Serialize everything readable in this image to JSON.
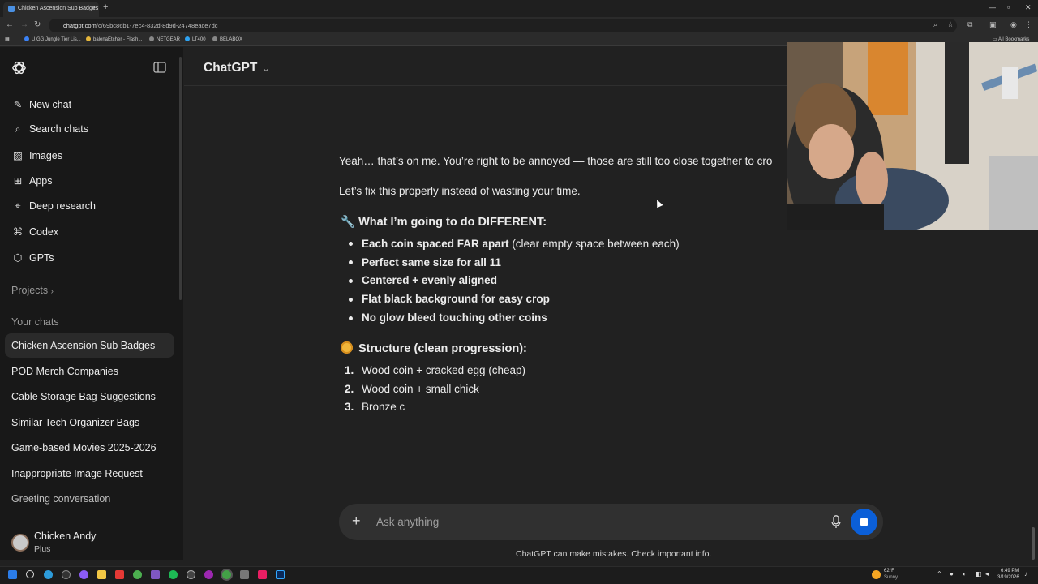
{
  "browser": {
    "tab_title": "Chicken Ascension Sub Badges",
    "url_host": "chatgpt.com",
    "url_path": "/c/69bc86b1-7ec4-832d-8d9d-24748eace7dc",
    "bookmarks": [
      "U.GG Jungle Tier Lis...",
      "balenaEtcher - Flash...",
      "NETGEAR",
      "LT400",
      "BELABOX"
    ],
    "all_bookmarks": "All Bookmarks"
  },
  "sidebar": {
    "nav": [
      {
        "label": "New chat",
        "icon": "pencil-square-icon"
      },
      {
        "label": "Search chats",
        "icon": "search-icon"
      },
      {
        "label": "Images",
        "icon": "image-icon"
      },
      {
        "label": "Apps",
        "icon": "apps-grid-icon"
      },
      {
        "label": "Deep research",
        "icon": "telescope-icon"
      },
      {
        "label": "Codex",
        "icon": "codex-icon"
      },
      {
        "label": "GPTs",
        "icon": "cube-icon"
      }
    ],
    "projects_label": "Projects",
    "your_chats_label": "Your chats",
    "chats": [
      "Chicken Ascension Sub Badges",
      "POD Merch Companies",
      "Cable Storage Bag Suggestions",
      "Similar Tech Organizer Bags",
      "Game-based Movies 2025-2026",
      "Inappropriate Image Request",
      "Greeting conversation"
    ],
    "user": {
      "name": "Chicken Andy",
      "plan": "Plus"
    }
  },
  "header": {
    "title": "ChatGPT"
  },
  "message": {
    "line1": "Yeah… that’s on me. You’re right to be annoyed — those are still too close together to cro",
    "line2": "Let’s fix this properly instead of wasting your time.",
    "heading1_emoji": "🔧",
    "heading1": "What I’m going to do DIFFERENT:",
    "bullets": [
      {
        "bold": "Each coin spaced FAR apart",
        "rest": " (clear empty space between each)"
      },
      {
        "bold": "Perfect same size for all 11",
        "rest": ""
      },
      {
        "bold": "Centered + evenly aligned",
        "rest": ""
      },
      {
        "bold": "Flat black background for easy crop",
        "rest": ""
      },
      {
        "bold": "No glow bleed touching other coins",
        "rest": ""
      }
    ],
    "heading2": "Structure (clean progression):",
    "numbered": [
      {
        "n": "1.",
        "text": "Wood coin + cracked egg (cheap)"
      },
      {
        "n": "2.",
        "text": "Wood coin + small chick"
      },
      {
        "n": "3.",
        "text": "Bronze c"
      }
    ]
  },
  "composer": {
    "placeholder": "Ask anything"
  },
  "disclaimer": "ChatGPT can make mistakes. Check important info.",
  "taskbar": {
    "weather_temp": "62°F",
    "weather_cond": "Sunny",
    "time": "6:49 PM",
    "date": "3/19/2026"
  },
  "colors": {
    "accent": "#0b5fd8",
    "bg": "#212121",
    "sidebar": "#181818"
  }
}
